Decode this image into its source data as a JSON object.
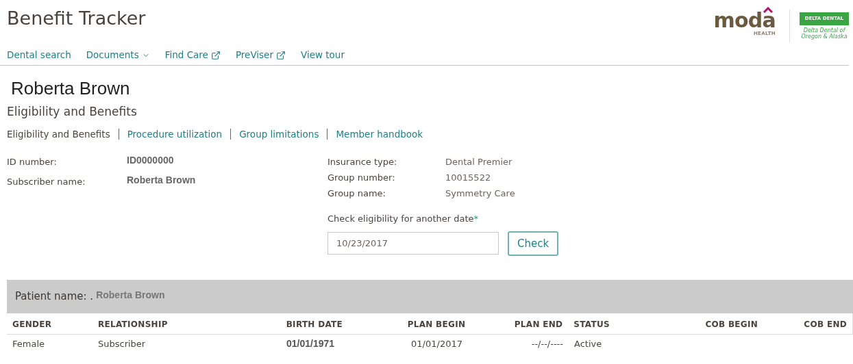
{
  "header": {
    "title": "Benefit Tracker",
    "logo_primary": {
      "wordmark": "moda",
      "subtitle": "HEALTH"
    },
    "logo_secondary": {
      "badge": "DELTA DENTAL",
      "caption": "Delta Dental of Oregon & Alaska"
    }
  },
  "nav": [
    {
      "label": "Dental search",
      "kind": "link"
    },
    {
      "label": "Documents",
      "kind": "dropdown"
    },
    {
      "label": "Find Care",
      "kind": "external"
    },
    {
      "label": "PreViser",
      "kind": "external"
    },
    {
      "label": "View tour",
      "kind": "link"
    }
  ],
  "member_name": "Roberta Brown",
  "section_title": "Eligibility and Benefits",
  "subnav": [
    {
      "label": "Eligibility and Benefits",
      "selected": true
    },
    {
      "label": "Procedure utilization",
      "selected": false
    },
    {
      "label": "Group limitations",
      "selected": false
    },
    {
      "label": "Member handbook",
      "selected": false
    }
  ],
  "member_info": [
    {
      "label": "ID number:",
      "value": "ID0000000"
    },
    {
      "label": "Subscriber name:",
      "value": "Roberta Brown"
    }
  ],
  "plan_info": [
    {
      "label": "Insurance type:",
      "value": "Dental Premier"
    },
    {
      "label": "Group number:",
      "value": "10015522"
    },
    {
      "label": "Group name:",
      "value": "Symmetry Care"
    }
  ],
  "date_check": {
    "label": "Check eligibility for another date",
    "required_mark": "*",
    "value": "10/23/2017",
    "button": "Check"
  },
  "patient": {
    "label": "Patient name: .",
    "name": "Roberta Brown"
  },
  "table": {
    "columns": [
      "GENDER",
      "RELATIONSHIP",
      "BIRTH DATE",
      "PLAN BEGIN",
      "PLAN END",
      "STATUS",
      "COB BEGIN",
      "COB END"
    ],
    "rows": [
      [
        "Female",
        "Subscriber",
        "01/01/1971",
        "01/01/2017",
        "--/--/----",
        "Active",
        "",
        ""
      ]
    ]
  }
}
